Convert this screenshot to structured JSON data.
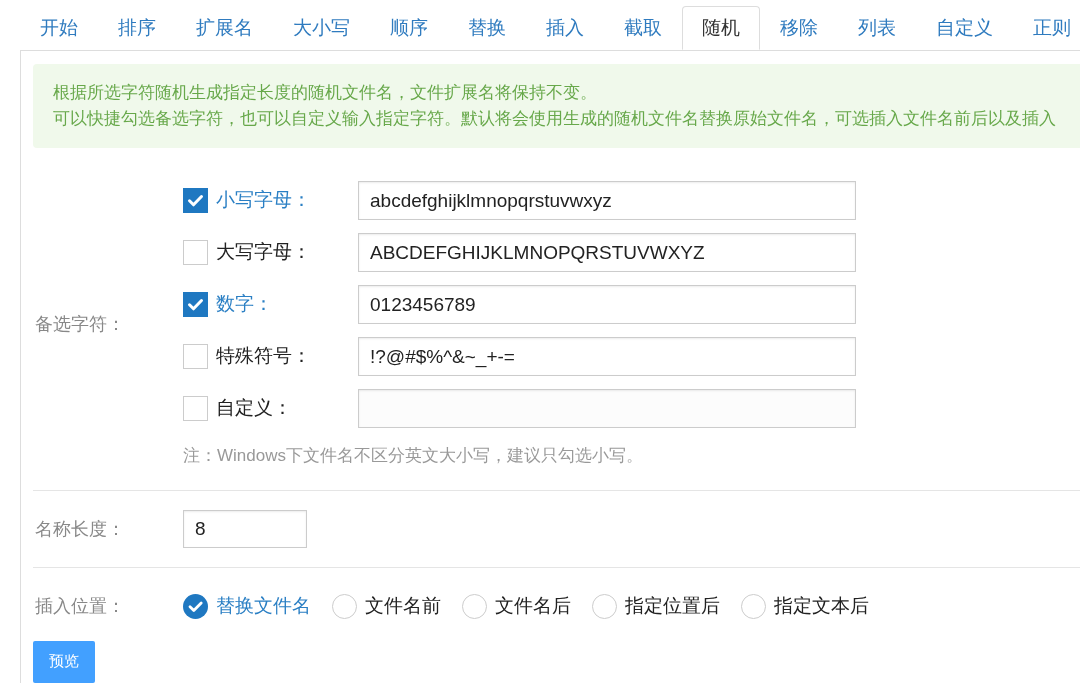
{
  "tabs": [
    {
      "label": "开始",
      "selected": false
    },
    {
      "label": "排序",
      "selected": false
    },
    {
      "label": "扩展名",
      "selected": false
    },
    {
      "label": "大小写",
      "selected": false
    },
    {
      "label": "顺序",
      "selected": false
    },
    {
      "label": "替换",
      "selected": false
    },
    {
      "label": "插入",
      "selected": false
    },
    {
      "label": "截取",
      "selected": false
    },
    {
      "label": "随机",
      "selected": true
    },
    {
      "label": "移除",
      "selected": false
    },
    {
      "label": "列表",
      "selected": false
    },
    {
      "label": "自定义",
      "selected": false
    },
    {
      "label": "正则",
      "selected": false
    }
  ],
  "info": {
    "lines": [
      "根据所选字符随机生成指定长度的随机文件名，文件扩展名将保持不变。",
      "可以快捷勾选备选字符，也可以自定义输入指定字符。默认将会使用生成的随机文件名替换原始文件名，可选插入文件名前后以及插入"
    ]
  },
  "charset": {
    "label": "备选字符：",
    "options": [
      {
        "label": "小写字母：",
        "checked": true,
        "value": "abcdefghijklmnopqrstuvwxyz"
      },
      {
        "label": "大写字母：",
        "checked": false,
        "value": "ABCDEFGHIJKLMNOPQRSTUVWXYZ"
      },
      {
        "label": "数字：",
        "checked": true,
        "value": "0123456789"
      },
      {
        "label": "特殊符号：",
        "checked": false,
        "value": "!?@#$%^&~_+-="
      },
      {
        "label": "自定义：",
        "checked": false
      }
    ],
    "note": "注：Windows下文件名不区分英文大小写，建议只勾选小写。"
  },
  "length": {
    "label": "名称长度：",
    "value": "8"
  },
  "position": {
    "label": "插入位置：",
    "options": [
      {
        "label": "替换文件名",
        "selected": true
      },
      {
        "label": "文件名前",
        "selected": false
      },
      {
        "label": "文件名后",
        "selected": false
      },
      {
        "label": "指定位置后",
        "selected": false
      },
      {
        "label": "指定文本后",
        "selected": false
      }
    ]
  },
  "buttons": [
    "预览"
  ]
}
